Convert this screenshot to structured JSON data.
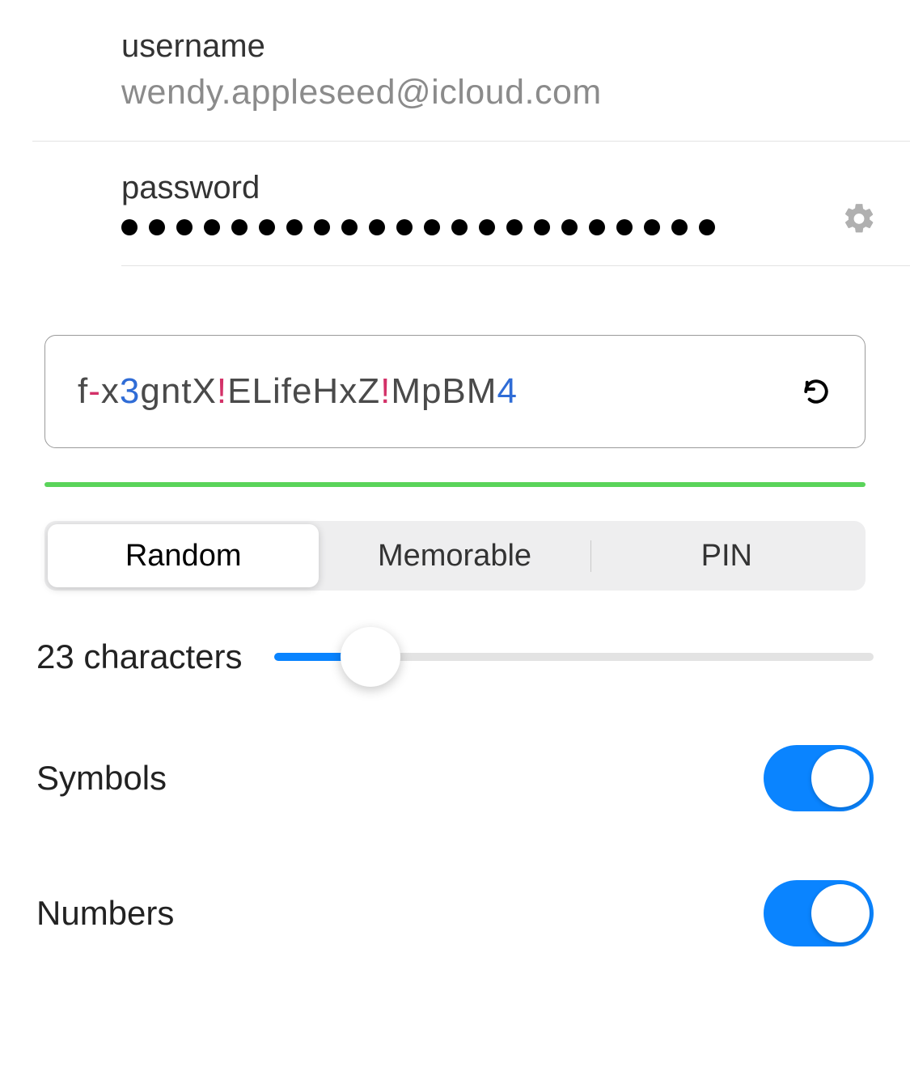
{
  "fields": {
    "username": {
      "label": "username",
      "value": "wendy.appleseed@icloud.com"
    },
    "password": {
      "label": "password",
      "masked_length": 22
    }
  },
  "generator": {
    "generated": {
      "parts": [
        {
          "t": "f",
          "c": "plain"
        },
        {
          "t": "-",
          "c": "sym"
        },
        {
          "t": "x",
          "c": "plain"
        },
        {
          "t": "3",
          "c": "num"
        },
        {
          "t": "gntX",
          "c": "plain"
        },
        {
          "t": "!",
          "c": "sym"
        },
        {
          "t": "ELifeHxZ",
          "c": "plain"
        },
        {
          "t": "!",
          "c": "sym"
        },
        {
          "t": "MpBM",
          "c": "plain"
        },
        {
          "t": "4",
          "c": "num"
        }
      ]
    },
    "strength_color": "#5ad45a",
    "segments": {
      "options": [
        "Random",
        "Memorable",
        "PIN"
      ],
      "active": 0
    },
    "length": {
      "label": "23 characters",
      "value": 23
    },
    "toggles": {
      "symbols": {
        "label": "Symbols",
        "on": true
      },
      "numbers": {
        "label": "Numbers",
        "on": true
      }
    }
  },
  "colors": {
    "accent": "#0a84ff",
    "symbol": "#d33168",
    "number": "#2f6cd6"
  }
}
